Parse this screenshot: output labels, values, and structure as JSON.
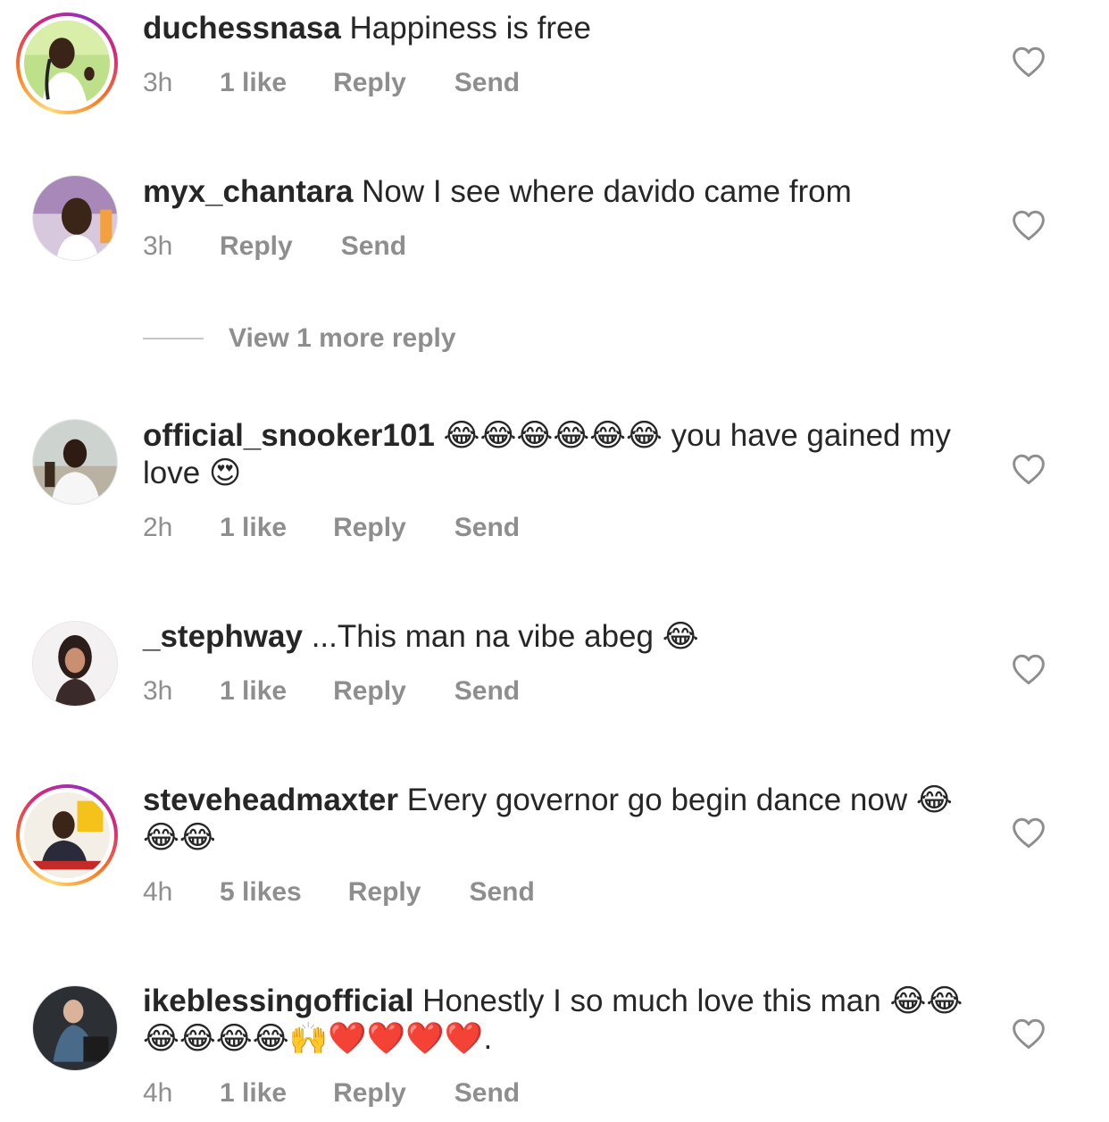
{
  "comments": [
    {
      "username": "duchessnasa",
      "text": "Happiness is free",
      "time": "3h",
      "likes": "1 like",
      "reply": "Reply",
      "send": "Send",
      "avatar_ring": true
    },
    {
      "username": "myx_chantara",
      "text": "Now I see where davido came from",
      "time": "3h",
      "likes": "",
      "reply": "Reply",
      "send": "Send",
      "avatar_ring": false,
      "view_more": "View 1 more reply"
    },
    {
      "username": "official_snooker101",
      "text": "😂😂😂😂😂😂 you have gained my love 😍",
      "time": "2h",
      "likes": "1 like",
      "reply": "Reply",
      "send": "Send",
      "avatar_ring": false
    },
    {
      "username": "_stephway",
      "text": "...This man na vibe abeg 😂",
      "time": "3h",
      "likes": "1 like",
      "reply": "Reply",
      "send": "Send",
      "avatar_ring": false
    },
    {
      "username": "steveheadmaxter",
      "text": "Every governor go begin dance now 😂😂😂",
      "time": "4h",
      "likes": "5 likes",
      "reply": "Reply",
      "send": "Send",
      "avatar_ring": true
    },
    {
      "username": "ikeblessingofficial",
      "text": "Honestly I so much love this man 😂😂😂😂😂😂🙌❤️❤️❤️❤️.",
      "time": "4h",
      "likes": "1 like",
      "reply": "Reply",
      "send": "Send",
      "avatar_ring": false
    }
  ],
  "icons": {
    "heart": "heart-outline-icon"
  },
  "colors": {
    "text": "#262626",
    "meta": "#8e8e8e",
    "divider": "#c7c7c7"
  }
}
